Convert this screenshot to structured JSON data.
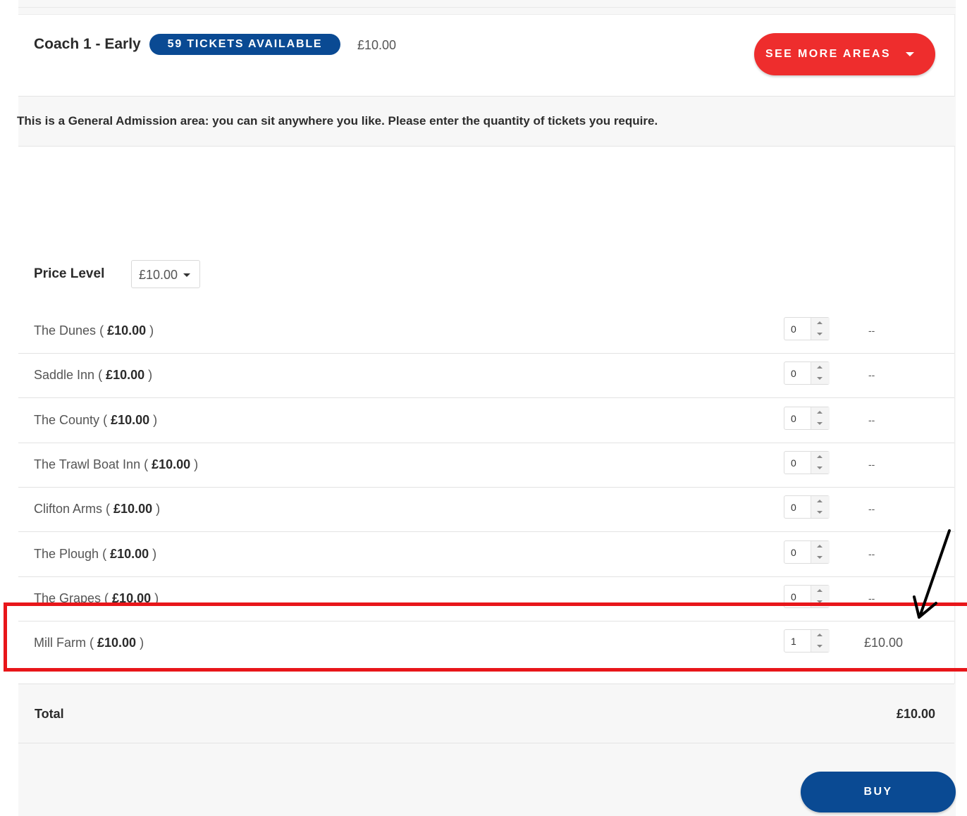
{
  "header": {
    "area_name": "Coach 1 - Early",
    "availability": "59 TICKETS AVAILABLE",
    "price": "£10.00",
    "see_more_label": "SEE MORE AREAS"
  },
  "info_text": "This is a General Admission area: you can sit anywhere you like. Please enter the quantity of tickets you require.",
  "price_level": {
    "label": "Price Level",
    "selected": "£10.00"
  },
  "rows": [
    {
      "name": "The Dunes",
      "price": "£10.00",
      "qty": "0",
      "subtotal": "--"
    },
    {
      "name": "Saddle Inn",
      "price": "£10.00",
      "qty": "0",
      "subtotal": "--"
    },
    {
      "name": "The County",
      "price": "£10.00",
      "qty": "0",
      "subtotal": "--"
    },
    {
      "name": "The Trawl Boat Inn",
      "price": "£10.00",
      "qty": "0",
      "subtotal": "--"
    },
    {
      "name": "Clifton Arms",
      "price": "£10.00",
      "qty": "0",
      "subtotal": "--"
    },
    {
      "name": "The Plough",
      "price": "£10.00",
      "qty": "0",
      "subtotal": "--"
    },
    {
      "name": "The Grapes",
      "price": "£10.00",
      "qty": "0",
      "subtotal": "--"
    },
    {
      "name": "Mill Farm",
      "price": "£10.00",
      "qty": "1",
      "subtotal": "£10.00"
    }
  ],
  "total": {
    "label": "Total",
    "amount": "£10.00"
  },
  "buy_label": "BUY",
  "colors": {
    "brand_blue": "#0a4a93",
    "accent_red": "#ee2d2d",
    "annotation_red": "#e8161a"
  },
  "annotations": {
    "highlight_row": "Mill Farm"
  }
}
